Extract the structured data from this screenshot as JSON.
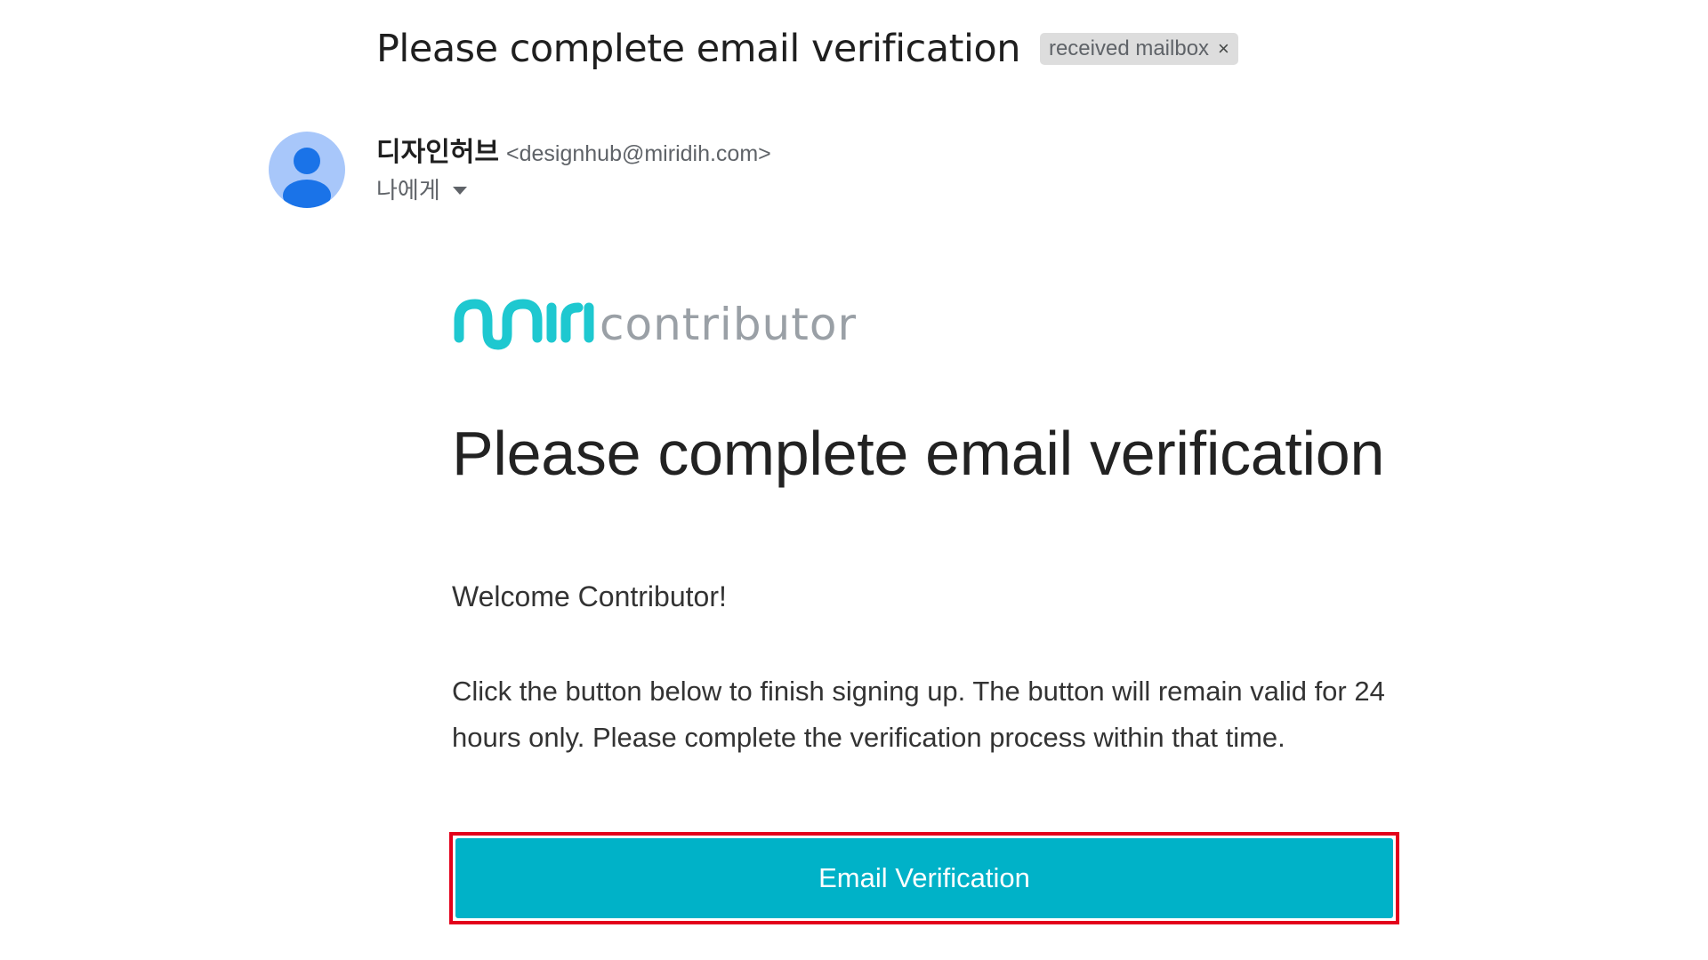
{
  "email": {
    "subject": "Please complete email verification",
    "label_chip": {
      "text": "received mailbox",
      "close_glyph": "×"
    },
    "sender": {
      "name": "디자인허브",
      "address": "<designhub@miridih.com>",
      "recipient": "나에게"
    },
    "avatar_icon": "person-icon"
  },
  "body": {
    "logo": {
      "mark": "miri",
      "word": "contributor",
      "mark_color": "#1ec8d0",
      "word_color": "#9aa0a6"
    },
    "title": "Please complete email verification",
    "welcome": "Welcome Contributor!",
    "instructions": "Click the button below to finish signing up. The button will remain valid for 24 hours only. Please complete the verification process within that time.",
    "button_label": "Email Verification",
    "button_color": "#00b2c8",
    "highlight_color": "#e3001b"
  }
}
